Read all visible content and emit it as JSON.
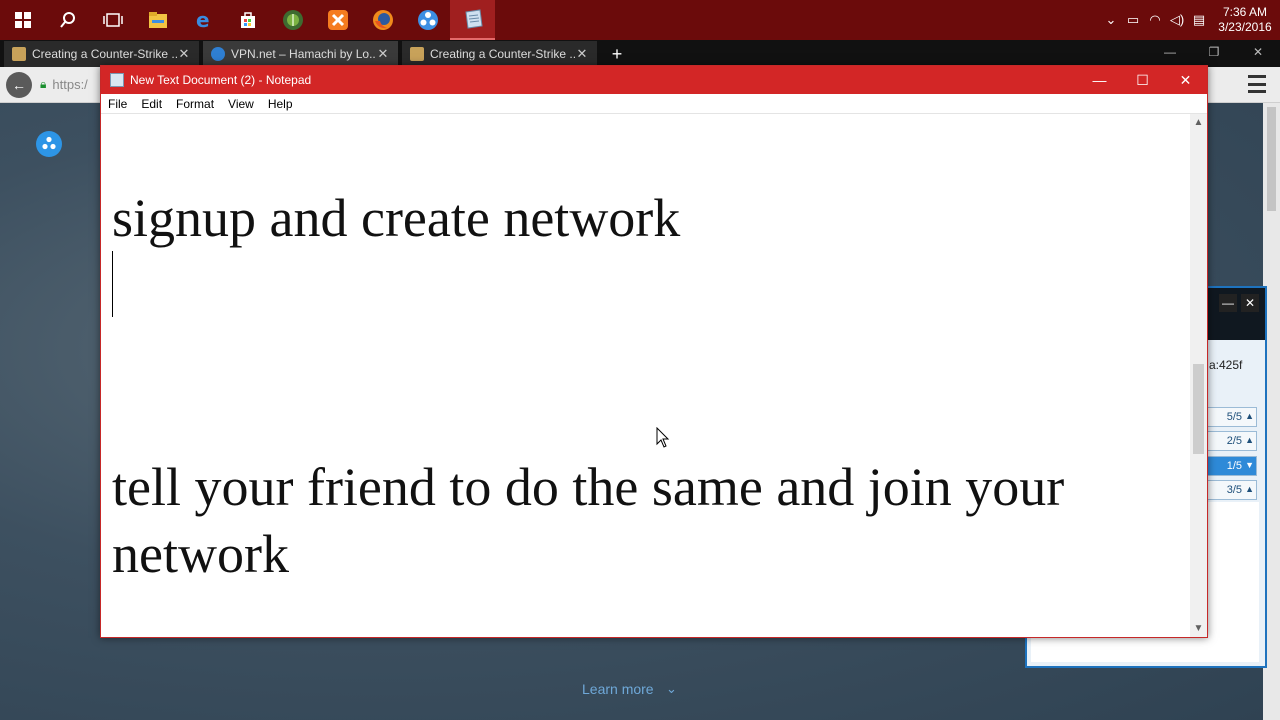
{
  "taskbar": {
    "start_icon": "windows-start-icon",
    "pinned": [
      {
        "name": "search-icon",
        "glyph": "⚲"
      },
      {
        "name": "task-view-icon",
        "glyph": "❐"
      },
      {
        "name": "file-explorer-icon",
        "glyph": "▬",
        "color": "#f2c343"
      },
      {
        "name": "edge-icon",
        "glyph": "e",
        "color": "#3a8be0"
      },
      {
        "name": "store-icon",
        "glyph": "⊞",
        "color": "#ffffff"
      },
      {
        "name": "android-studio-icon",
        "glyph": "●",
        "color": "#7cb342"
      },
      {
        "name": "xampp-icon",
        "glyph": "✕",
        "color": "#f57c20"
      },
      {
        "name": "firefox-icon",
        "glyph": "●",
        "color": "#f08a1c"
      },
      {
        "name": "hamachi-icon",
        "glyph": "●",
        "color": "#3d8fe3"
      },
      {
        "name": "notepad-icon",
        "glyph": "▤",
        "color": "#cfe0f0"
      }
    ],
    "tray": {
      "time": "7:36 AM",
      "date": "3/23/2016"
    }
  },
  "browser": {
    "tabs": [
      {
        "label": "Creating a Counter-Strike ...",
        "active": false
      },
      {
        "label": "VPN.net – Hamachi by Lo...",
        "active": true
      },
      {
        "label": "Creating a Counter-Strike ...",
        "active": false
      }
    ],
    "new_tab": "+",
    "address": "https:/"
  },
  "webpage": {
    "learn_more": "Learn more"
  },
  "hamachi": {
    "address_fragment": "a:425f",
    "network_rows": [
      {
        "count": "5/5",
        "selected": false
      },
      {
        "count": "2/5",
        "selected": false
      },
      {
        "count": "1/5",
        "selected": true
      },
      {
        "count": "3/5",
        "selected": false
      }
    ]
  },
  "notepad": {
    "title": "New Text Document (2) - Notepad",
    "menu": [
      "File",
      "Edit",
      "Format",
      "View",
      "Help"
    ],
    "lines": {
      "line1": "signup and create network",
      "line2": "tell your friend to do the same and join your",
      "line3": "network"
    }
  }
}
